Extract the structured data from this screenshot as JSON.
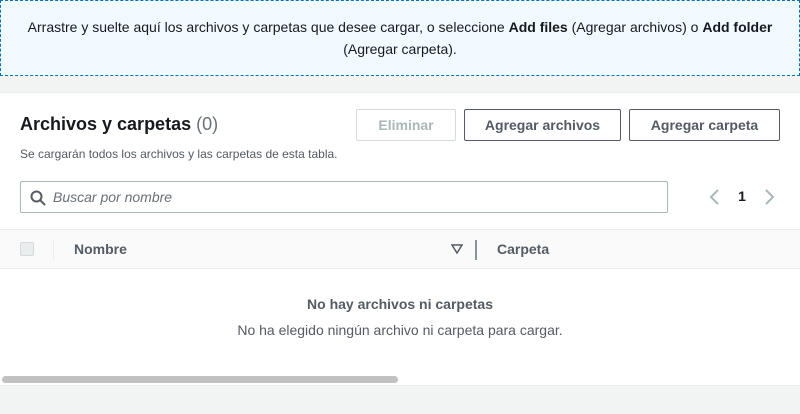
{
  "dropzone": {
    "text_before": "Arrastre y suelte aquí los archivos y carpetas que desee cargar, o seleccione ",
    "add_files": "Add files",
    "text_middle": " (Agregar archivos) o ",
    "add_folder": "Add folder",
    "text_after": " (Agregar carpeta)."
  },
  "panel": {
    "title": "Archivos y carpetas",
    "count": "(0)",
    "subtitle": "Se cargarán todos los archivos y las carpetas de esta tabla.",
    "buttons": {
      "remove": "Eliminar",
      "add_files": "Agregar archivos",
      "add_folder": "Agregar carpeta"
    },
    "search": {
      "placeholder": "Buscar por nombre",
      "icon": "search-icon"
    },
    "pagination": {
      "current_page": "1",
      "prev_icon": "chevron-left-icon",
      "next_icon": "chevron-right-icon"
    },
    "table": {
      "columns": [
        "Nombre",
        "Carpeta"
      ],
      "sort_icon": "sort-down-icon"
    },
    "empty": {
      "title": "No hay archivos ni carpetas",
      "description": "No ha elegido ningún archivo ni carpeta para cargar."
    }
  },
  "colors": {
    "dropzone_border": "#0073bb",
    "dropzone_bg": "#f1faff",
    "button_border": "#545b64",
    "disabled": "#aab7b8"
  }
}
